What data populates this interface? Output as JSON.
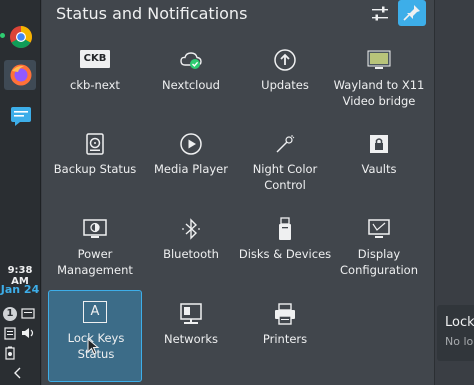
{
  "taskbar": {
    "apps": [
      {
        "icon": "chrome-icon"
      },
      {
        "icon": "firefox-icon"
      },
      {
        "icon": "chat-icon"
      }
    ],
    "clock": "9:38 AM",
    "date": "Jan 24",
    "tray_badge": "1"
  },
  "panel": {
    "title": "Status and Notifications",
    "items": [
      {
        "label": "ckb-next",
        "icon": "ckb-icon",
        "icon_text": "CKB"
      },
      {
        "label": "Nextcloud",
        "icon": "nextcloud-icon"
      },
      {
        "label": "Updates",
        "icon": "updates-icon"
      },
      {
        "label": "Wayland to X11 Video bridge",
        "icon": "video-bridge-icon"
      },
      {
        "label": "Backup Status",
        "icon": "backup-icon"
      },
      {
        "label": "Media Player",
        "icon": "media-player-icon"
      },
      {
        "label": "Night Color Control",
        "icon": "night-color-icon"
      },
      {
        "label": "Vaults",
        "icon": "vaults-icon"
      },
      {
        "label": "Power Management",
        "icon": "power-icon"
      },
      {
        "label": "Bluetooth",
        "icon": "bluetooth-icon"
      },
      {
        "label": "Disks & Devices",
        "icon": "disks-icon"
      },
      {
        "label": "Display Configuration",
        "icon": "display-icon"
      },
      {
        "label": "Lock Keys Status",
        "icon": "lock-keys-icon",
        "icon_text": "A",
        "selected": true
      },
      {
        "label": "Networks",
        "icon": "networks-icon"
      },
      {
        "label": "Printers",
        "icon": "printers-icon"
      }
    ]
  },
  "tooltip": {
    "title": "Lock",
    "subtitle": "No lo"
  },
  "colors": {
    "accent": "#3daee9",
    "panel_bg": "#41464c",
    "taskbar_bg": "#2a2e32",
    "nextcloud_check": "#2ecc71"
  }
}
